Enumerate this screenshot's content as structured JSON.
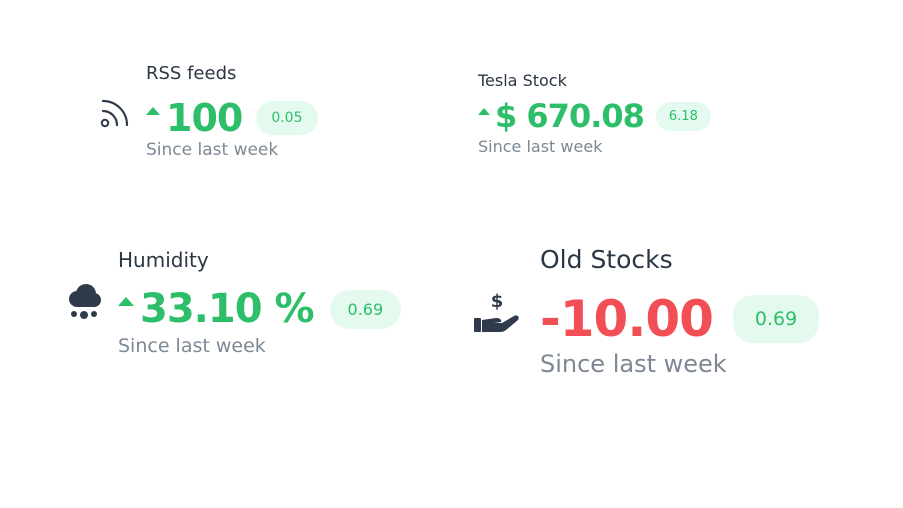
{
  "widgets": [
    {
      "title": "RSS feeds",
      "icon": "rss-icon",
      "trend": "up",
      "value": "100",
      "badge": "0.05",
      "since": "Since last week"
    },
    {
      "title": "Tesla Stock",
      "icon": "",
      "trend": "up",
      "value": "$ 670.08",
      "badge": "6.18",
      "since": "Since last week"
    },
    {
      "title": "Humidity",
      "icon": "cloud-rain-icon",
      "trend": "up",
      "value": "33.10 %",
      "badge": "0.69",
      "since": "Since last week"
    },
    {
      "title": "Old Stocks",
      "icon": "hand-holding-dollar-icon",
      "trend": "down",
      "value": "-10.00",
      "badge": "0.69",
      "since": "Since last week"
    }
  ],
  "colors": {
    "positive": "#2dbe6a",
    "negative": "#f14f55",
    "badge_bg": "#e4faef",
    "title": "#2b3645",
    "muted": "#7d8894",
    "icon": "#2f3a4b"
  }
}
